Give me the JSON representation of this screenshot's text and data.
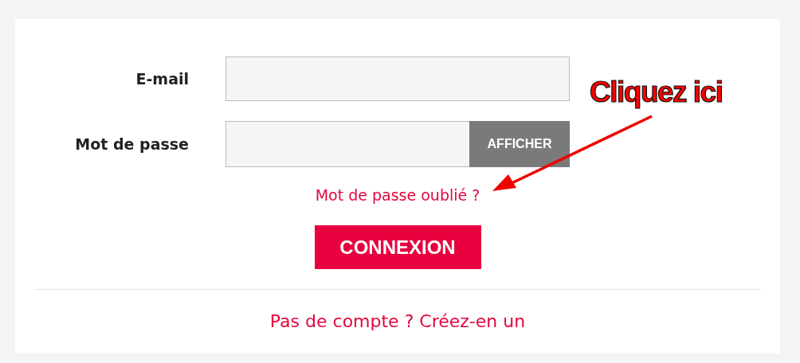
{
  "login_form": {
    "fields": [
      {
        "label": "E-mail",
        "kind": "email"
      },
      {
        "label": "Mot de passe",
        "kind": "password",
        "action": "AFFICHER"
      }
    ],
    "forgot_link": "Mot de passe oublié ?",
    "submit": "CONNEXION",
    "signup_link": "Pas de compte ? Créez-en un"
  },
  "annotation": {
    "text": "Cliquez ici"
  }
}
